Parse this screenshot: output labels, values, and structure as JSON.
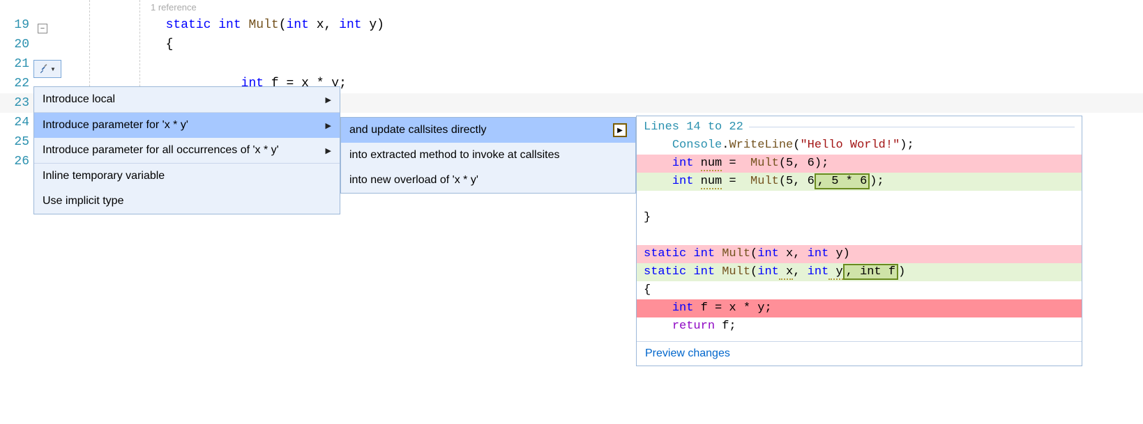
{
  "gutter": {
    "lines": [
      "19",
      "20",
      "21",
      "22",
      "23",
      "24",
      "25",
      "26"
    ]
  },
  "codelens": {
    "text": "1 reference"
  },
  "code": {
    "line19": {
      "kw_static": "static",
      "kw_int": "int",
      "method": "Mult",
      "params_open": "(",
      "p1_type": "int",
      "p1_name": "x",
      "comma": ", ",
      "p2_type": "int",
      "p2_name": "y",
      "params_close": ")"
    },
    "line20": {
      "brace": "{"
    },
    "line21": {
      "kw_int": "int",
      "ident_f": "f",
      "eq": " = ",
      "x": "x",
      "star": " * ",
      "y": "y",
      "semi": ";"
    }
  },
  "menu1": {
    "items": [
      {
        "label": "Introduce local",
        "hasSub": true
      },
      {
        "label": "Introduce parameter for 'x * y'",
        "hasSub": true,
        "selected": true
      },
      {
        "label": "Introduce parameter for all occurrences of 'x * y'",
        "hasSub": true
      },
      {
        "label": "Inline temporary variable",
        "hasSub": false
      },
      {
        "label": "Use implicit type",
        "hasSub": false
      }
    ]
  },
  "menu2": {
    "items": [
      {
        "label": "and update callsites directly",
        "selected": true,
        "arrowBox": true
      },
      {
        "label": "into extracted method to invoke at callsites"
      },
      {
        "label": "into new overload of 'x * y'"
      }
    ]
  },
  "preview": {
    "header": "Lines 14 to 22",
    "lines": {
      "l1_indent": "    ",
      "l1_console": "Console",
      "l1_dot": ".",
      "l1_write": "WriteLine",
      "l1_open": "(",
      "l1_str": "\"Hello World!\"",
      "l1_close": ");",
      "l2_indent": "    ",
      "l2_int": "int",
      "l2_sp": " ",
      "l2_num": "num",
      "l2_eq": " =  ",
      "l2_mult": "Mult",
      "l2_args": "(5, 6);",
      "l3_indent": "    ",
      "l3_int": "int",
      "l3_sp": " ",
      "l3_num": "num",
      "l3_eq": " =  ",
      "l3_mult": "Mult",
      "l3_args_a": "(5, 6",
      "l3_added": ", 5 * 6",
      "l3_args_b": ");",
      "l4_blank": "",
      "l5_brace": "}",
      "l6_blank": "",
      "l7_static": "static",
      "l7_sp1": " ",
      "l7_int": "int",
      "l7_sp2": " ",
      "l7_mult": "Mult",
      "l7_open": "(",
      "l7_p1t": "int",
      "l7_p1n": " x, ",
      "l7_p2t": "int",
      "l7_p2n": " y)",
      "l8_static": "static",
      "l8_sp1": " ",
      "l8_int": "int",
      "l8_sp2": " ",
      "l8_mult": "Mult",
      "l8_open": "(",
      "l8_p1t": "int",
      "l8_p1n": " x",
      "l8_c1": ", ",
      "l8_p2t": "int",
      "l8_p2n": " y",
      "l8_added": ", int f",
      "l8_close": ")",
      "l9_brace": "{",
      "l10_indent": "    ",
      "l10_int": "int",
      "l10_rest": " f = x * y;",
      "l11_indent": "    ",
      "l11_return": "return",
      "l11_rest": " f;"
    },
    "footer": "Preview changes"
  }
}
